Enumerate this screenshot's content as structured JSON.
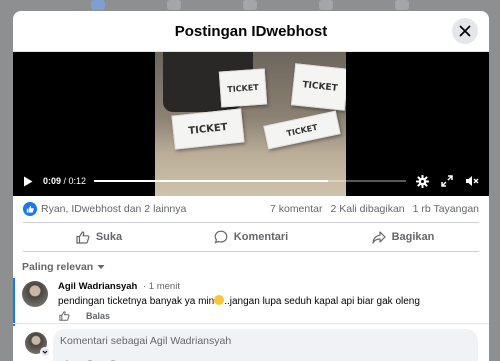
{
  "modal": {
    "title": "Postingan IDwebhost"
  },
  "video": {
    "current_time": "0:09",
    "duration": "0:12",
    "progress_fraction": 0.75,
    "cards": [
      "TICKET",
      "TICKET",
      "TICKET",
      "TICKET"
    ]
  },
  "stats": {
    "reactors": "Ryan, IDwebhost dan 2 lainnya",
    "comments": "7 komentar",
    "shares": "2 Kali dibagikan",
    "views": "1 rb Tayangan"
  },
  "actions": {
    "like": "Suka",
    "comment": "Komentari",
    "share": "Bagikan"
  },
  "sort": {
    "label": "Paling relevan"
  },
  "comment": {
    "author": "Agil Wadriansyah",
    "time": "· 1 menit",
    "text_before": "pendingan ticketnya banyak ya min",
    "text_after": "..jangan lupa seduh kapal api biar gak oleng",
    "reply": "Balas"
  },
  "composer": {
    "placeholder": "Komentari sebagai Agil Wadriansyah"
  },
  "colors": {
    "accent": "#1877f2",
    "secondary_text": "#65676b",
    "backdrop": "#8e8f91"
  }
}
